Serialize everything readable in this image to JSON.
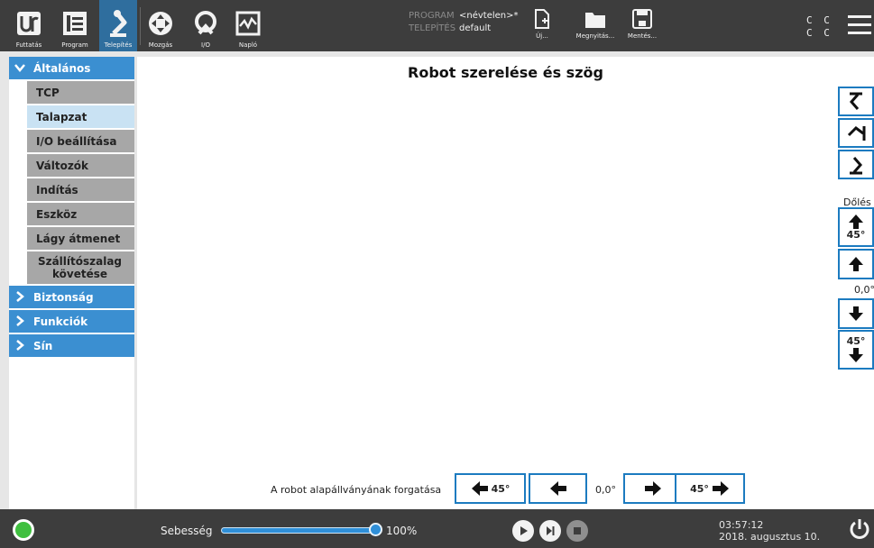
{
  "header": {
    "nav": [
      {
        "label": "Futtatás",
        "icon": "ur-logo-icon"
      },
      {
        "label": "Program",
        "icon": "program-icon"
      },
      {
        "label": "Telepítés",
        "icon": "robot-arm-icon",
        "active": true
      },
      {
        "label": "Mozgás",
        "icon": "move-icon"
      },
      {
        "label": "I/O",
        "icon": "io-icon"
      },
      {
        "label": "Napló",
        "icon": "log-icon"
      }
    ],
    "program_key": "PROGRAM",
    "program_value": "<névtelen>*",
    "installation_key": "TELEPÍTÉS",
    "installation_value": "default",
    "file_buttons": [
      {
        "label": "Új...",
        "icon": "new-file-icon"
      },
      {
        "label": "Megnyitás...",
        "icon": "folder-icon"
      },
      {
        "label": "Mentés...",
        "icon": "save-icon"
      }
    ],
    "cc_line1": "C C",
    "cc_line2": "C C"
  },
  "sidebar": {
    "general": "Általános",
    "items": [
      {
        "label": "TCP"
      },
      {
        "label": "Talapzat",
        "selected": true
      },
      {
        "label": "I/O beállítása"
      },
      {
        "label": "Változók"
      },
      {
        "label": "Indítás"
      },
      {
        "label": "Eszköz"
      },
      {
        "label": "Lágy átmenet"
      },
      {
        "label": "Szállítószalag követése"
      }
    ],
    "sections": [
      "Biztonság",
      "Funkciók",
      "Sín"
    ]
  },
  "main": {
    "title": "Robot szerelése és szög",
    "tilt_label": "Dőlés",
    "tilt_step": "45°",
    "tilt_value": "0,0°",
    "rotate_label": "A robot alapállványának forgatása",
    "rotate_step": "45°",
    "rotate_value": "0,0°"
  },
  "footer": {
    "speed_label": "Sebesség",
    "speed_value": "100%",
    "speed_fraction": 1.0,
    "time": "03:57:12",
    "date": "2018. augusztus 10."
  },
  "colors": {
    "accent": "#3b8fd1",
    "header_bg": "#3d3d3d",
    "active_tab": "#2f6e9e",
    "selected_item": "#c9e2f3"
  }
}
